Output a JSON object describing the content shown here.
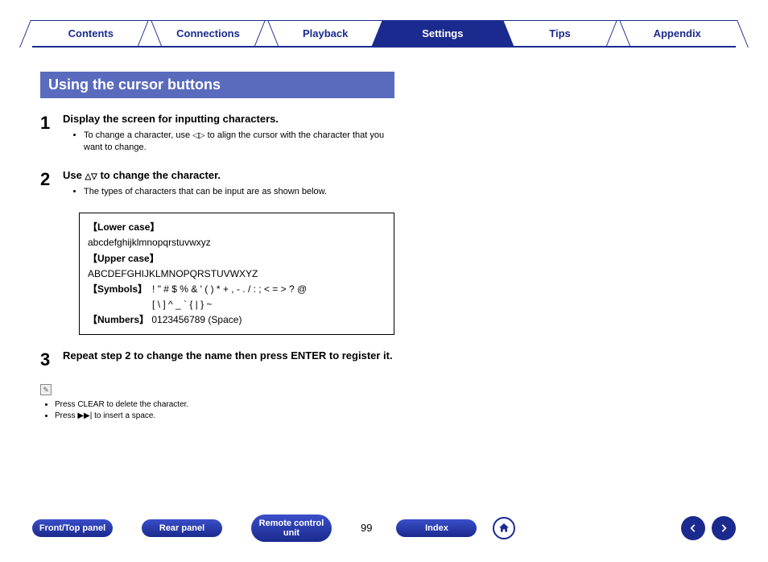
{
  "tabs": [
    {
      "label": "Contents",
      "active": false
    },
    {
      "label": "Connections",
      "active": false
    },
    {
      "label": "Playback",
      "active": false
    },
    {
      "label": "Settings",
      "active": true
    },
    {
      "label": "Tips",
      "active": false
    },
    {
      "label": "Appendix",
      "active": false
    }
  ],
  "section_title": "Using the cursor buttons",
  "steps": {
    "s1": {
      "num": "1",
      "title": "Display the screen for inputting characters.",
      "bullet_pre": "To change a character, use ",
      "bullet_post": " to align the cursor with the character that you want to change."
    },
    "s2": {
      "num": "2",
      "title_pre": "Use ",
      "title_post": " to change the character.",
      "bullet": "The types of characters that can be input are as shown below."
    },
    "s3": {
      "num": "3",
      "title": "Repeat step 2 to change the name then press ENTER to register it."
    }
  },
  "charbox": {
    "lower_label": "【Lower case】",
    "lower_chars": "abcdefghijklmnopqrstuvwxyz",
    "upper_label": "【Upper case】",
    "upper_chars": "ABCDEFGHIJKLMNOPQRSTUVWXYZ",
    "symbols_label": "【Symbols】",
    "symbols_line1": "! \" # $ % & ' ( ) * + , - . / : ; < = > ? @",
    "symbols_line2": "[ \\ ] ^ _ ` { | } ~",
    "numbers_label": "【Numbers】",
    "numbers_chars": "0123456789   (Space)"
  },
  "notes": {
    "n1": "Press CLEAR to delete the character.",
    "n2_pre": "Press ",
    "n2_icon": "▶▶|",
    "n2_post": " to insert a space."
  },
  "footer": {
    "btn1": "Front/Top panel",
    "btn2": "Rear panel",
    "btn3": "Remote control unit",
    "page": "99",
    "btn4": "Index"
  }
}
